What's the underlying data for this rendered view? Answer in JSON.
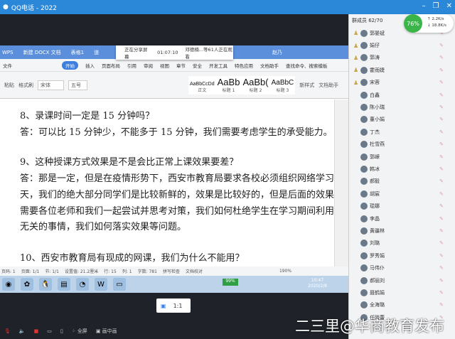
{
  "window": {
    "title": "QQ电话 - 2022",
    "min": "–",
    "restore": "❐",
    "close": "✕"
  },
  "wps": {
    "tabs": [
      "WPS",
      "新建 DOCX 文档",
      "表格1",
      "道",
      "+"
    ],
    "user": "赵乃"
  },
  "share_banner": {
    "status": "正在分享屏幕",
    "time": "01:07:10",
    "viewers": "邓德楠...等61人正在观看"
  },
  "menu": [
    "文件",
    "开始",
    "插入",
    "页面布局",
    "引用",
    "审阅",
    "视图",
    "章节",
    "安全",
    "开发工具",
    "特色应用",
    "文档助手"
  ],
  "menu_active": "开始",
  "search": "查找命令、搜索模板",
  "ribbon": {
    "paste": "粘贴",
    "format_painter": "格式刷",
    "font": "宋体",
    "size": "五号",
    "styles": [
      "AaBbCcDd",
      "AaBb",
      "AaBb(",
      "AaBbC"
    ],
    "style_labels": [
      "正文",
      "标题 1",
      "标题 2",
      "标题 3"
    ],
    "new_style": "新样式",
    "doc_helper": "文档助手"
  },
  "doc": {
    "lines": [
      "8、录课时间一定是 15 分钟吗？",
      "答：可以比 15 分钟少，不能多于 15 分钟，我们需要考虑学生的承受能力。",
      "9、这种授课方式效果是不是会比正常上课效果要差？",
      "答：那是一定，但是在疫情形势下，西安市教育局要求各校必须组织网络学习，我估计",
      "天，我们的绝大部分同学们是比较新鲜的，效果是比较好的，但是后面的效果如何保",
      "需要各位老师和我们一起尝试并思考对策，我们如何杜绝学生在学习期间利用网络干",
      "无关的事情，我们如何落实效果等问题。",
      "10、西安市教育局有现成的网课，我们为什么不能用？"
    ]
  },
  "statusbar": [
    "页码: 1",
    "页面: 1/1",
    "节: 1/1",
    "设置值: 21.2厘米",
    "行: 15",
    "列: 1",
    "字数: 781",
    "拼写检查",
    "文档校对",
    "190%"
  ],
  "taskbar": {
    "battery": "99%",
    "time": "10:47",
    "date": "2020/2/8"
  },
  "ratio_button": "1:1",
  "bottombar": {
    "fullscreen": "全屏",
    "pip": "画中画"
  },
  "network": {
    "percent": "76%",
    "up": "2.2K/s",
    "down": "18.8K/s"
  },
  "panel": {
    "header": "群成员 62/70",
    "members": [
      "郭晏斌",
      "娟仔",
      "郭涛",
      "霍雨婕",
      "宋蓉",
      "白鑫",
      "陈小瑞",
      "董小娟",
      "丁杰",
      "杜雪燕",
      "郭嵘",
      "韩冰",
      "郝毅",
      "胡宸",
      "琨娜",
      "李晶",
      "黄疆林",
      "刘璐",
      "罗秀娟",
      "马伟仆",
      "郝丽刘",
      "聂鹤娟",
      "全海璐",
      "任晓蕾"
    ]
  },
  "watermark": "二三里@华商教育发布"
}
